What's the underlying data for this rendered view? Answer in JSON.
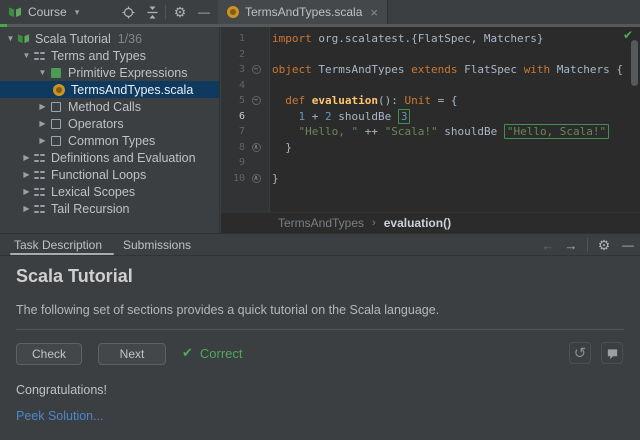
{
  "toolbar": {
    "course_label": "Course"
  },
  "editor_tab": {
    "label": "TermsAndTypes.scala"
  },
  "icons": {
    "expand": "▼",
    "collapse_item": "▶",
    "dropdown": "▾",
    "close": "×",
    "back": "←",
    "forward": "→",
    "gear": "⚙",
    "minimize": "—",
    "undo": "↺",
    "check": "✔",
    "breadcrumb_chevron": "›"
  },
  "tree": {
    "items": [
      {
        "arrow": "v",
        "icon": "book",
        "label": "Scala Tutorial",
        "suffix": "1/36",
        "level": 0,
        "selected": false
      },
      {
        "arrow": "v",
        "icon": "grid",
        "label": "Terms and Types",
        "suffix": "",
        "level": 1,
        "selected": false
      },
      {
        "arrow": "v",
        "icon": "solved",
        "label": "Primitive Expressions",
        "suffix": "",
        "level": 2,
        "selected": false
      },
      {
        "arrow": "",
        "icon": "scala",
        "label": "TermsAndTypes.scala",
        "suffix": "",
        "level": 3,
        "selected": true
      },
      {
        "arrow": ">",
        "icon": "square",
        "label": "Method Calls",
        "suffix": "",
        "level": 2,
        "selected": false
      },
      {
        "arrow": ">",
        "icon": "square",
        "label": "Operators",
        "suffix": "",
        "level": 2,
        "selected": false
      },
      {
        "arrow": ">",
        "icon": "square",
        "label": "Common Types",
        "suffix": "",
        "level": 2,
        "selected": false
      },
      {
        "arrow": ">",
        "icon": "grid",
        "label": "Definitions and Evaluation",
        "suffix": "",
        "level": 1,
        "selected": false
      },
      {
        "arrow": ">",
        "icon": "grid",
        "label": "Functional Loops",
        "suffix": "",
        "level": 1,
        "selected": false
      },
      {
        "arrow": ">",
        "icon": "grid",
        "label": "Lexical Scopes",
        "suffix": "",
        "level": 1,
        "selected": false
      },
      {
        "arrow": ">",
        "icon": "grid",
        "label": "Tail Recursion",
        "suffix": "",
        "level": 1,
        "selected": false
      }
    ]
  },
  "editor": {
    "lines": [
      {
        "n": "1",
        "g": "",
        "cur": false,
        "tk": [
          [
            "k",
            "import"
          ],
          [
            "d",
            " org.scalatest.{FlatSpec, Matchers}"
          ]
        ]
      },
      {
        "n": "2",
        "g": "",
        "cur": false,
        "tk": []
      },
      {
        "n": "3",
        "g": "open",
        "cur": false,
        "tk": [
          [
            "k",
            "object"
          ],
          [
            "d",
            " TermsAndTypes "
          ],
          [
            "k",
            "extends"
          ],
          [
            "d",
            " FlatSpec "
          ],
          [
            "k",
            "with"
          ],
          [
            "d",
            " Matchers {"
          ]
        ]
      },
      {
        "n": "4",
        "g": "",
        "cur": false,
        "tk": []
      },
      {
        "n": "5",
        "g": "open",
        "cur": false,
        "tk": [
          [
            "d",
            "  "
          ],
          [
            "k",
            "def"
          ],
          [
            "d",
            " "
          ],
          [
            "f",
            "evaluation"
          ],
          [
            "d",
            "(): "
          ],
          [
            "k",
            "Unit"
          ],
          [
            "d",
            " = {"
          ]
        ]
      },
      {
        "n": "6",
        "g": "",
        "cur": true,
        "tk": [
          [
            "d",
            "    "
          ],
          [
            "n",
            "1"
          ],
          [
            "d",
            " + "
          ],
          [
            "n",
            "2"
          ],
          [
            "d",
            " shouldBe "
          ],
          [
            "n",
            "3",
            "box"
          ]
        ]
      },
      {
        "n": "7",
        "g": "",
        "cur": false,
        "tk": [
          [
            "d",
            "    "
          ],
          [
            "s",
            "\"Hello, \""
          ],
          [
            "d",
            " ++ "
          ],
          [
            "s",
            "\"Scala!\""
          ],
          [
            "d",
            " shouldBe "
          ],
          [
            "s",
            "\"Hello, Scala!\"",
            "box"
          ]
        ]
      },
      {
        "n": "8",
        "g": "close",
        "cur": false,
        "tk": [
          [
            "d",
            "  }"
          ]
        ]
      },
      {
        "n": "9",
        "g": "",
        "cur": false,
        "tk": []
      },
      {
        "n": "10",
        "g": "close",
        "cur": false,
        "tk": [
          [
            "d",
            "}"
          ]
        ]
      }
    ],
    "breadcrumb_parent": "TermsAndTypes",
    "breadcrumb_current": "evaluation()"
  },
  "bottom_tabs": {
    "items": [
      {
        "label": "Task Description",
        "active": true
      },
      {
        "label": "Submissions",
        "active": false
      }
    ]
  },
  "task_panel": {
    "title": "Scala Tutorial",
    "description": "The following set of sections provides a quick tutorial on the Scala language.",
    "check_label": "Check",
    "next_label": "Next",
    "status_label": "Correct",
    "congrats": "Congratulations!",
    "peek_link": "Peek Solution..."
  },
  "colors": {
    "panel_bg": "#3C3F41",
    "editor_bg": "#2B2B2B",
    "selection_blue": "#0D3A5E",
    "keyword_orange": "#CC7832",
    "string_green": "#6A8759",
    "number_blue": "#6897BB",
    "function_yellow": "#FFC66D",
    "placeholder_border_green": "#3F9154",
    "correct_green": "#4DAA57",
    "link_blue": "#4B87C9",
    "progress_green": "#4CA54C"
  }
}
